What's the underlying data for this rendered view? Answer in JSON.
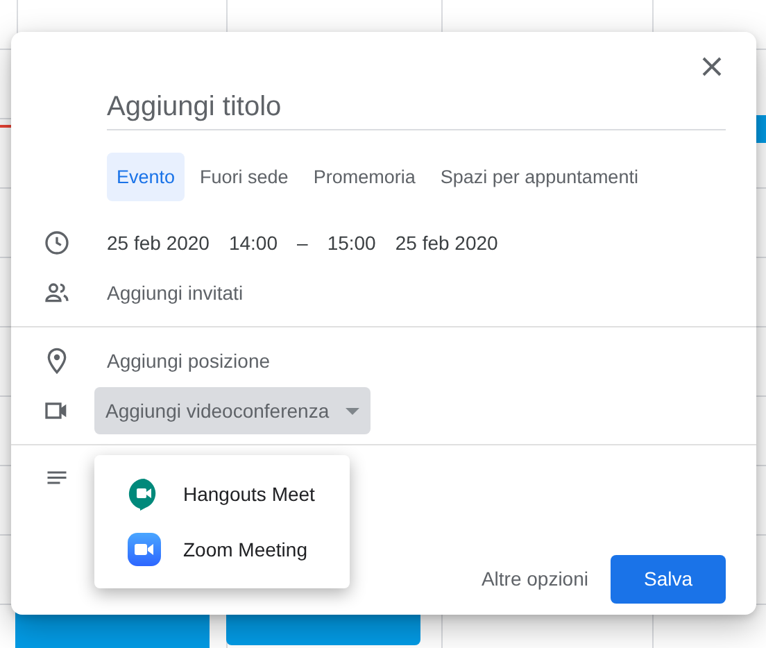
{
  "dialog": {
    "title_field": {
      "placeholder": "Aggiungi titolo"
    },
    "tabs": [
      {
        "label": "Evento",
        "selected": true
      },
      {
        "label": "Fuori sede",
        "selected": false
      },
      {
        "label": "Promemoria",
        "selected": false
      },
      {
        "label": "Spazi per appuntamenti",
        "selected": false
      }
    ],
    "date_time": {
      "start_date": "25 feb 2020",
      "start_time": "14:00",
      "separator": "–",
      "end_time": "15:00",
      "end_date": "25 feb 2020"
    },
    "guests": {
      "placeholder": "Aggiungi invitati"
    },
    "location": {
      "placeholder": "Aggiungi posizione"
    },
    "conference": {
      "label": "Aggiungi videoconferenza",
      "expanded": true
    },
    "conference_menu": [
      {
        "label": "Hangouts Meet",
        "kind": "meet"
      },
      {
        "label": "Zoom Meeting",
        "kind": "zoom"
      }
    ],
    "buttons": {
      "more_options": "Altre opzioni",
      "save": "Salva"
    }
  }
}
